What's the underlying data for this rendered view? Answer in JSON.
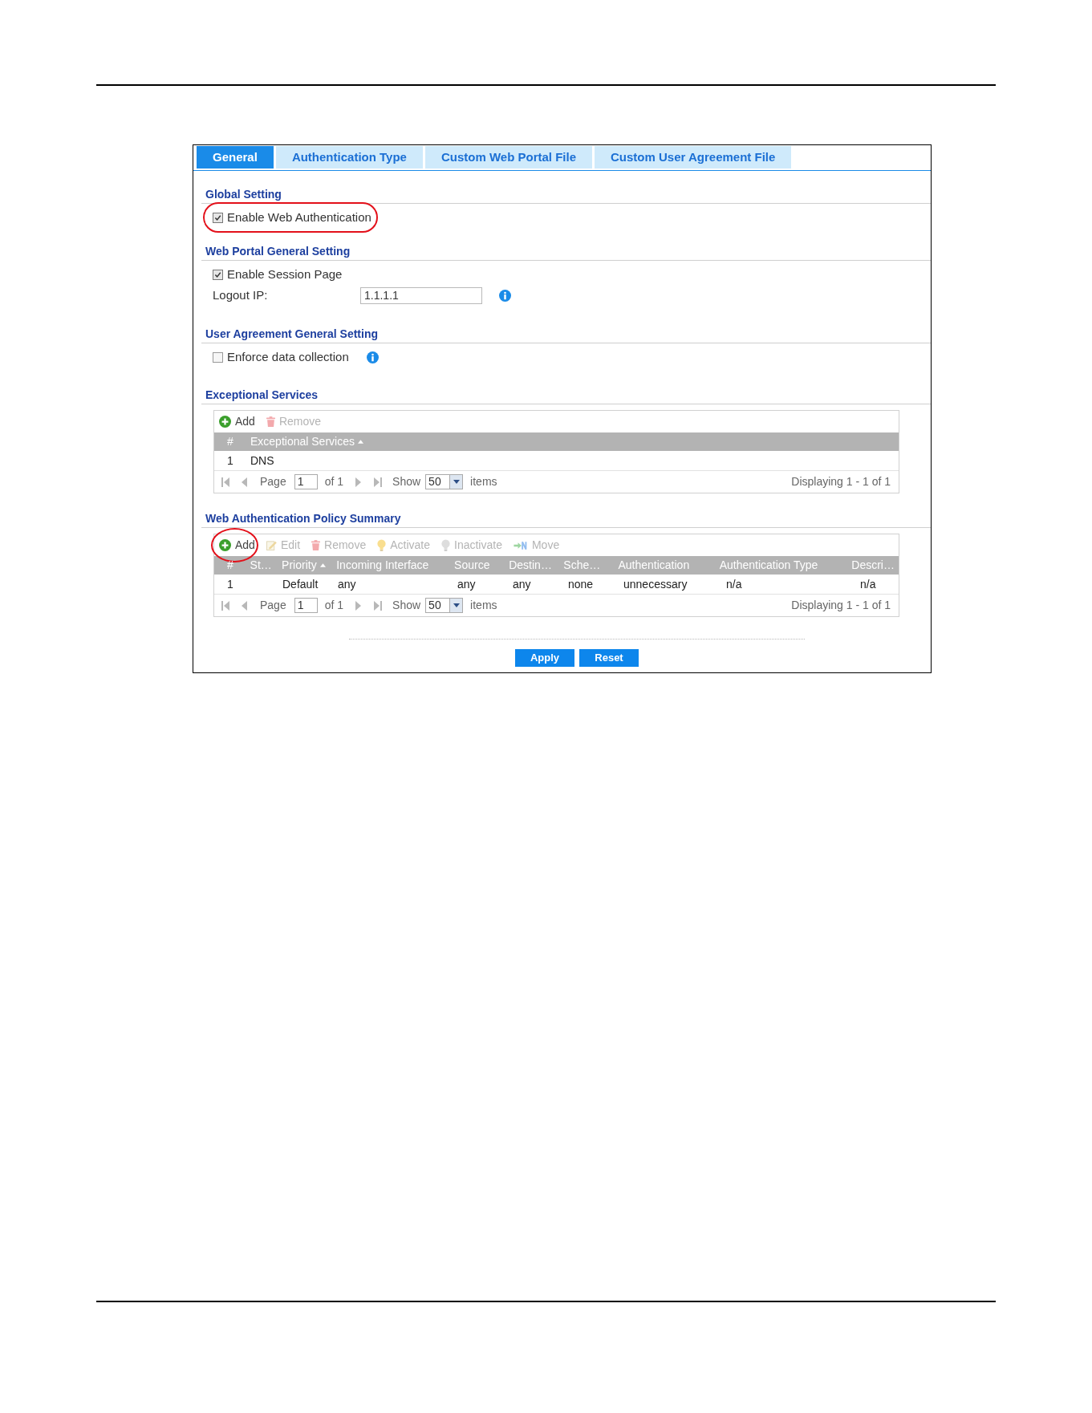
{
  "tabs": [
    {
      "label": "General",
      "selected": true
    },
    {
      "label": "Authentication Type",
      "selected": false
    },
    {
      "label": "Custom Web Portal File",
      "selected": false
    },
    {
      "label": "Custom User Agreement File",
      "selected": false
    }
  ],
  "sections": [
    {
      "kind": "form",
      "title": "Global Setting",
      "fields": [
        {
          "kind": "checkbox",
          "label": "Enable Web Authentication",
          "checked": true,
          "info": false,
          "highlighted": true
        }
      ]
    },
    {
      "kind": "form",
      "title": "Web Portal General Setting",
      "fields": [
        {
          "kind": "checkbox",
          "label": "Enable Session Page",
          "checked": true,
          "info": false,
          "highlighted": false
        },
        {
          "kind": "text",
          "label": "Logout IP:",
          "value": "1.1.1.1",
          "info": true
        }
      ]
    },
    {
      "kind": "form",
      "title": "User Agreement General Setting",
      "fields": [
        {
          "kind": "checkbox",
          "label": "Enforce data collection",
          "checked": false,
          "info": true,
          "highlighted": false
        }
      ]
    },
    {
      "kind": "table",
      "title": "Exceptional Services",
      "toolbar": [
        {
          "kind": "add",
          "label": "Add",
          "disabled": false,
          "highlighted": false
        },
        {
          "kind": "remove",
          "label": "Remove",
          "disabled": true,
          "highlighted": false
        }
      ],
      "columns": [
        {
          "label": "#",
          "sorted": false
        },
        {
          "label": "Exceptional Services",
          "sorted": true
        }
      ],
      "rows": [
        [
          "1",
          "DNS"
        ]
      ],
      "pager": {
        "page_label": "Page",
        "page": "1",
        "of_label": "of 1",
        "show_label": "Show",
        "page_size": "50",
        "items_label": "items",
        "summary": "Displaying 1 - 1 of 1"
      }
    },
    {
      "kind": "table",
      "title": "Web Authentication Policy Summary",
      "toolbar": [
        {
          "kind": "add",
          "label": "Add",
          "disabled": false,
          "highlighted": true
        },
        {
          "kind": "edit",
          "label": "Edit",
          "disabled": true,
          "highlighted": false
        },
        {
          "kind": "remove",
          "label": "Remove",
          "disabled": true,
          "highlighted": false
        },
        {
          "kind": "activate",
          "label": "Activate",
          "disabled": true,
          "highlighted": false
        },
        {
          "kind": "inactivate",
          "label": "Inactivate",
          "disabled": true,
          "highlighted": false
        },
        {
          "kind": "move",
          "label": "Move",
          "disabled": true,
          "highlighted": false
        }
      ],
      "columns": [
        {
          "label": "#",
          "sorted": false
        },
        {
          "label": "St…",
          "sorted": false
        },
        {
          "label": "Priority",
          "sorted": true
        },
        {
          "label": "Incoming Interface",
          "sorted": false
        },
        {
          "label": "Source",
          "sorted": false
        },
        {
          "label": "Destin…",
          "sorted": false
        },
        {
          "label": "Sche…",
          "sorted": false
        },
        {
          "label": "Authentication",
          "sorted": false
        },
        {
          "label": "Authentication Type",
          "sorted": false
        },
        {
          "label": "Descri…",
          "sorted": false
        }
      ],
      "rows": [
        [
          "1",
          null,
          "Default",
          "any",
          "any",
          "any",
          "none",
          "unnecessary",
          "n/a",
          "n/a"
        ]
      ],
      "pager": {
        "page_label": "Page",
        "page": "1",
        "of_label": "of 1",
        "show_label": "Show",
        "page_size": "50",
        "items_label": "items",
        "summary": "Displaying 1 - 1 of 1"
      }
    }
  ],
  "buttons": [
    "Apply",
    "Reset"
  ]
}
